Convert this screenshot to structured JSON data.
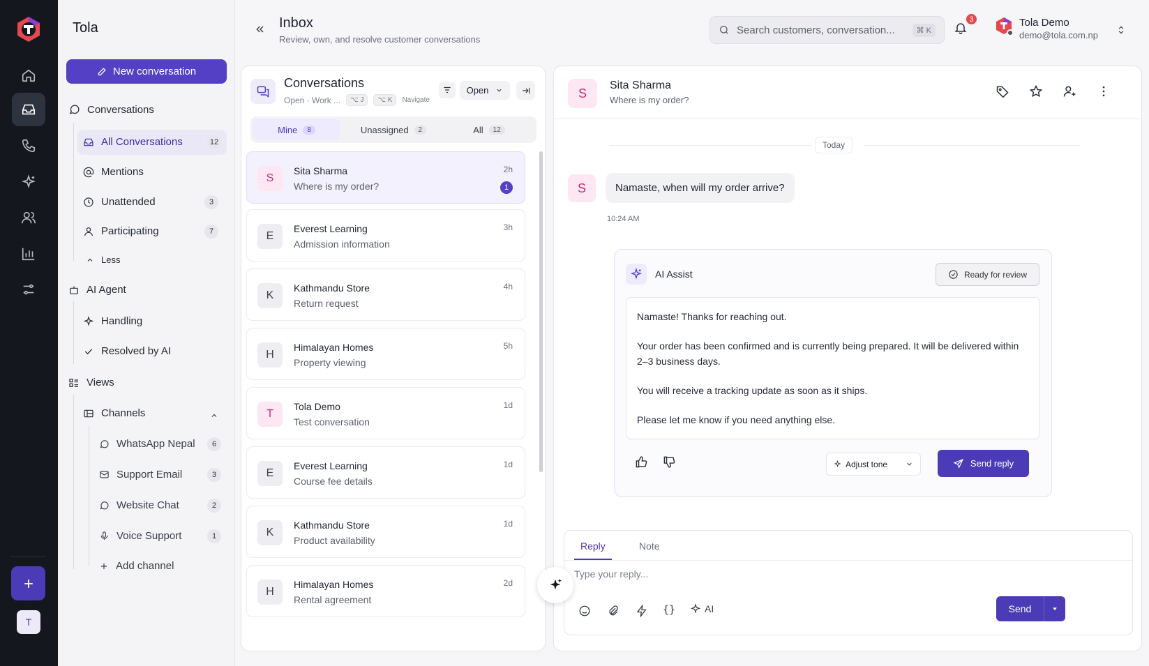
{
  "workspace": "Tola",
  "rail": {
    "avatar": "T",
    "icons": [
      "home-icon",
      "inbox-icon",
      "phone-icon",
      "sparkles-icon",
      "users-icon",
      "chart-icon",
      "sliders-icon"
    ]
  },
  "sidebar": {
    "new_button": "New conversation",
    "conversations_label": "Conversations",
    "items": [
      {
        "label": "All Conversations",
        "count": "12"
      },
      {
        "label": "Mentions",
        "count": ""
      },
      {
        "label": "Unattended",
        "count": "3"
      },
      {
        "label": "Participating",
        "count": "7"
      }
    ],
    "less_label": "Less",
    "ai_agent_label": "AI Agent",
    "ai_items": [
      {
        "label": "Handling"
      },
      {
        "label": "Resolved by AI"
      }
    ],
    "views_label": "Views",
    "channels_label": "Channels",
    "channels": [
      {
        "label": "WhatsApp Nepal",
        "count": "6"
      },
      {
        "label": "Support Email",
        "count": "3"
      },
      {
        "label": "Website Chat",
        "count": "2"
      },
      {
        "label": "Voice Support",
        "count": "1"
      }
    ],
    "add_channel": "Add channel"
  },
  "header": {
    "title": "Inbox",
    "subtitle": "Review, own, and resolve customer conversations",
    "search_placeholder": "Search customers, conversation...",
    "search_kbd": "⌘ K",
    "notif_count": "3",
    "user_name": "Tola Demo",
    "user_email": "demo@tola.com.np"
  },
  "conversations": {
    "title": "Conversations",
    "subtitle": "Open · Work ...",
    "kbd1": "⌥ J",
    "kbd2": "⌥ K",
    "navigate": "Navigate",
    "filter_value": "Open",
    "tabs": [
      {
        "label": "Mine",
        "count": "8"
      },
      {
        "label": "Unassigned",
        "count": "2"
      },
      {
        "label": "All",
        "count": "12"
      }
    ],
    "items": [
      {
        "initial": "S",
        "name": "Sita Sharma",
        "preview": "Where is my order?",
        "time": "2h",
        "unread": "1"
      },
      {
        "initial": "E",
        "name": "Everest Learning",
        "preview": "Admission information",
        "time": "3h",
        "unread": ""
      },
      {
        "initial": "K",
        "name": "Kathmandu Store",
        "preview": "Return request",
        "time": "4h",
        "unread": ""
      },
      {
        "initial": "H",
        "name": "Himalayan Homes",
        "preview": "Property viewing",
        "time": "5h",
        "unread": ""
      },
      {
        "initial": "T",
        "name": "Tola Demo",
        "preview": "Test conversation",
        "time": "1d",
        "unread": ""
      },
      {
        "initial": "E",
        "name": "Everest Learning",
        "preview": "Course fee details",
        "time": "1d",
        "unread": ""
      },
      {
        "initial": "K",
        "name": "Kathmandu Store",
        "preview": "Product availability",
        "time": "1d",
        "unread": ""
      },
      {
        "initial": "H",
        "name": "Himalayan Homes",
        "preview": "Rental agreement",
        "time": "2d",
        "unread": ""
      }
    ]
  },
  "chat": {
    "initial": "S",
    "name": "Sita Sharma",
    "subject": "Where is my order?",
    "date_divider": "Today",
    "message": "Namaste, when will my order arrive?",
    "message_time": "10:24 AM",
    "ai": {
      "title": "AI Assist",
      "status": "Ready for review",
      "draft": [
        "Namaste! Thanks for reaching out.",
        "Your order has been confirmed and is currently being prepared. It will be delivered within 2–3 business days.",
        "You will receive a tracking update as soon as it ships.",
        "Please let me know if you need anything else."
      ],
      "adjust_tone": "Adjust tone",
      "send_reply": "Send reply"
    },
    "composer": {
      "tab_reply": "Reply",
      "tab_note": "Note",
      "placeholder": "Type your reply...",
      "ai_label": "AI",
      "send": "Send"
    }
  },
  "colors": {
    "accent": "#5340c4",
    "rail": "#15171f",
    "badge": "#e5484d"
  }
}
